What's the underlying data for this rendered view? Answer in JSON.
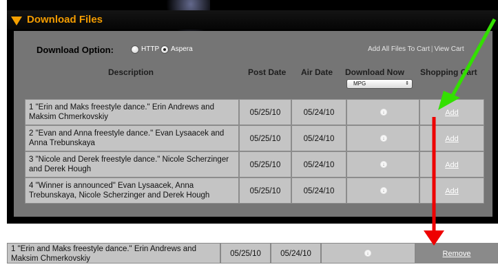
{
  "panel": {
    "title": "Download Files",
    "download_option_label": "Download Option:",
    "options": [
      {
        "label": "HTTP",
        "selected": false
      },
      {
        "label": "Aspera",
        "selected": true
      }
    ],
    "add_all_link": "Add All Files To Cart",
    "separator": "|",
    "view_cart_link": "View Cart",
    "columns": {
      "description": "Description",
      "post_date": "Post Date",
      "air_date": "Air Date",
      "download_now": "Download Now",
      "shopping_cart": "Shopping Cart"
    },
    "format_select": {
      "value": "MPG",
      "arrow": "⇕"
    }
  },
  "rows": [
    {
      "description": "1 \"Erin and Maks freestyle dance.\" Erin Andrews and Maksim Chmerkovskiy",
      "post_date": "05/25/10",
      "air_date": "05/24/10",
      "cart_label": "Add"
    },
    {
      "description": "2 \"Evan and Anna freestyle dance.\" Evan Lysaacek and Anna Trebunskaya",
      "post_date": "05/25/10",
      "air_date": "05/24/10",
      "cart_label": "Add"
    },
    {
      "description": "3 \"Nicole and Derek freestyle dance.\" Nicole Scherzinger and Derek Hough",
      "post_date": "05/25/10",
      "air_date": "05/24/10",
      "cart_label": "Add"
    },
    {
      "description": "4 \"Winner is announced\" Evan Lysaacek, Anna Trebunskaya, Nicole Scherzinger and Derek Hough",
      "post_date": "05/25/10",
      "air_date": "05/24/10",
      "cart_label": "Add"
    }
  ],
  "added_row": {
    "description": "1 \"Erin and Maks freestyle dance.\" Erin Andrews and Maksim Chmerkovskiy",
    "post_date": "05/25/10",
    "air_date": "05/24/10",
    "cart_label": "Remove"
  },
  "colors": {
    "header_accent": "#f39c00",
    "green_arrow": "#33e000",
    "red_arrow": "#ee0000"
  },
  "icons": {
    "section_toggle": "triangle-down-icon",
    "download": "download-circle-icon"
  }
}
